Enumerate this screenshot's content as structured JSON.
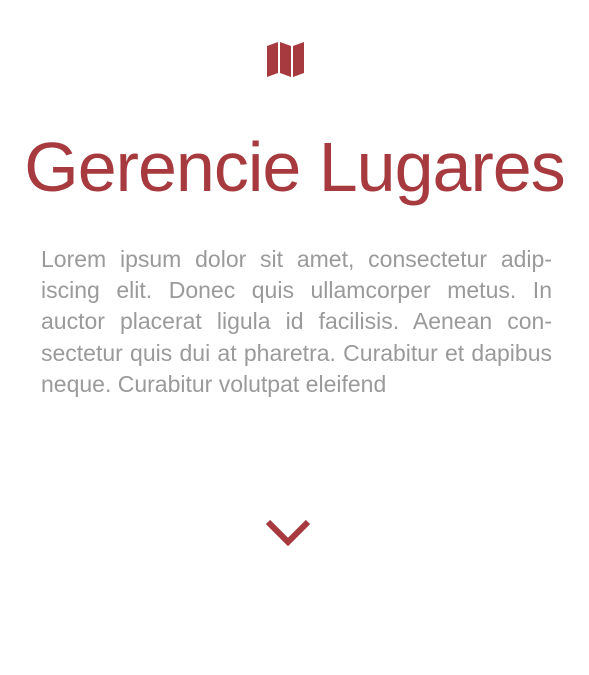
{
  "header": {
    "icon": "map-icon",
    "title": "Gerencie Lugares"
  },
  "main": {
    "description": "Lorem ipsum dolor sit amet, consectetur adip­iscing elit. Donec quis ullamcorper metus. In auctor placerat ligula id facilisis. Aenean con­sectetur quis dui at pharetra. Curabitur et dapibus neque. Curabitur volutpat eleifend"
  },
  "footer": {
    "scroll_icon": "chevron-down-icon"
  },
  "colors": {
    "accent": "#a63a3e",
    "text": "#9a9a9a",
    "background": "#ffffff"
  }
}
